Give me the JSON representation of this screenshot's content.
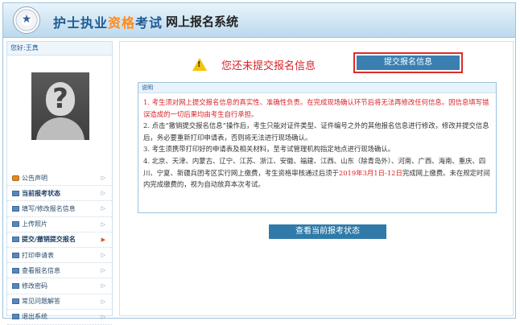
{
  "header": {
    "title_part1": "护士执业",
    "title_highlight": "资格",
    "title_part2": "考试",
    "subtitle": "网上报名系统"
  },
  "sidebar": {
    "greeting": "您好:王真",
    "menu": [
      {
        "label": "公告声明",
        "icon": "bell-icon"
      },
      {
        "label": "当前报考状态",
        "icon": "doc-icon"
      },
      {
        "label": "填写/修改报名信息",
        "icon": "doc-icon"
      },
      {
        "label": "上传照片",
        "icon": "doc-icon"
      },
      {
        "label": "提交/撤销提交报名",
        "icon": "doc-icon"
      },
      {
        "label": "打印申请表",
        "icon": "doc-icon"
      },
      {
        "label": "查看报名信息",
        "icon": "doc-icon"
      },
      {
        "label": "修改密码",
        "icon": "doc-icon"
      },
      {
        "label": "常见问题解答",
        "icon": "doc-icon"
      },
      {
        "label": "退出系统",
        "icon": "doc-icon"
      }
    ]
  },
  "main": {
    "warning_text": "您还未提交报名信息",
    "submit_button": "提交报名信息",
    "notice_title": "说明",
    "notice": {
      "p1": "1. 考生须对网上提交报名信息的真实性、准确性负责。在完成现场确认环节后将无法再修改任何信息。因信息填写错误造成的一切后果均由考生自行承担。",
      "p2": "2. 点击“撤销提交报名信息”操作后，考生只能对证件类型、证件编号之外的其他报名信息进行修改，修改并提交信息后，务必要重新打印申请表，否则将无法进行现场确认。",
      "p3": "3. 考生须携带打印好的申请表及相关材料，至考试管理机构指定地点进行现场确认。",
      "p4a": "4. 北京、天津、内蒙古、辽宁、江苏、浙江、安徽、福建、江西、山东（除青岛外）、河南、广西、海南、重庆、四川、宁夏、新疆兵团考区实行网上缴费，考生资格审核通过后须于",
      "p4_date": "2019年3月1日-12日",
      "p4b": "完成网上缴费。未在规定时间内完成缴费的，视为自动放弃本次考试。"
    },
    "status_button": "查看当前报考状态"
  },
  "colors": {
    "header_gradient_top": "#e9f4fb",
    "accent_blue": "#1f5a92",
    "highlight_orange": "#ff8a1a",
    "alert_red": "#d8232a",
    "button_blue": "#3a7fb0"
  }
}
